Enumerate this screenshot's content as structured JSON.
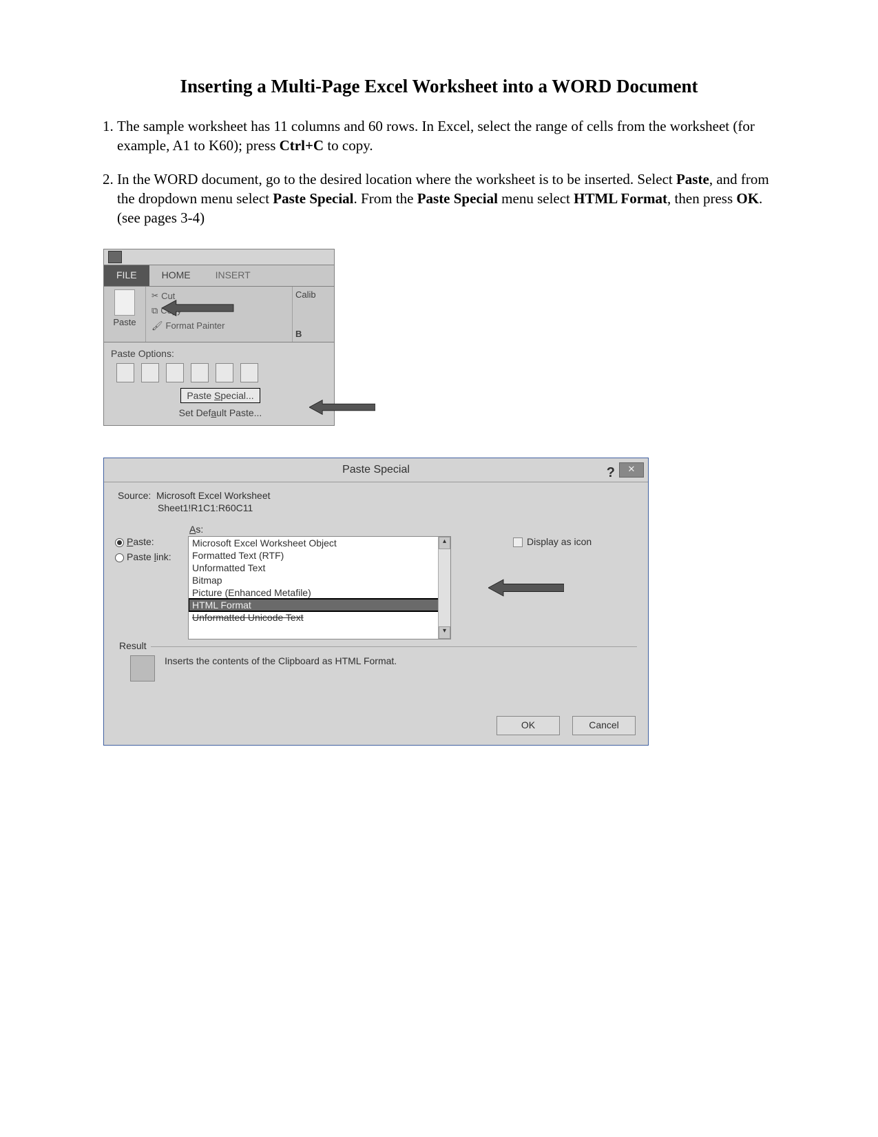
{
  "title": "Inserting a Multi-Page Excel Worksheet into a WORD Document",
  "steps": {
    "s1a": "The sample worksheet has 11 columns and 60 rows. In Excel, select the range of cells from the worksheet (for example, A1 to K60); press ",
    "s1b": "Ctrl+C",
    "s1c": " to copy.",
    "s2a": "In the WORD document, go to the desired location where the worksheet is to be inserted. Select ",
    "s2b": "Paste",
    "s2c": ", and from the dropdown menu select ",
    "s2d": "Paste Special",
    "s2e": ". From the ",
    "s2f": "Paste Special",
    "s2g": " menu select ",
    "s2h": "HTML Format",
    "s2i": ", then press ",
    "s2j": "OK",
    "s2k": ". (see pages 3-4)"
  },
  "ribbon": {
    "tabs": {
      "file": "FILE",
      "home": "HOME",
      "insert": "INSERT"
    },
    "paste": "Paste",
    "cut": "Cut",
    "copy": "Copy",
    "formatpainter": "Format Painter",
    "fontname": "Calib",
    "bold": "B",
    "pasteoptions": "Paste Options:",
    "pastespecial": "Paste Special...",
    "setdefault": "Set Default Paste..."
  },
  "dialog": {
    "title": "Paste Special",
    "help": "?",
    "close": "✕",
    "sourcelabel": "Source:",
    "source1": "Microsoft Excel Worksheet",
    "source2": "Sheet1!R1C1:R60C11",
    "paste": "Paste:",
    "pastelink": "Paste link:",
    "as": "As:",
    "list": {
      "o1": "Microsoft Excel Worksheet Object",
      "o2": "Formatted Text (RTF)",
      "o3": "Unformatted Text",
      "o4": "Bitmap",
      "o5": "Picture (Enhanced Metafile)",
      "o6": "HTML Format",
      "o7": "Unformatted Unicode Text"
    },
    "displayicon": "Display as icon",
    "resultlegend": "Result",
    "resulttext": "Inserts the contents of the Clipboard as HTML Format.",
    "ok": "OK",
    "cancel": "Cancel"
  }
}
